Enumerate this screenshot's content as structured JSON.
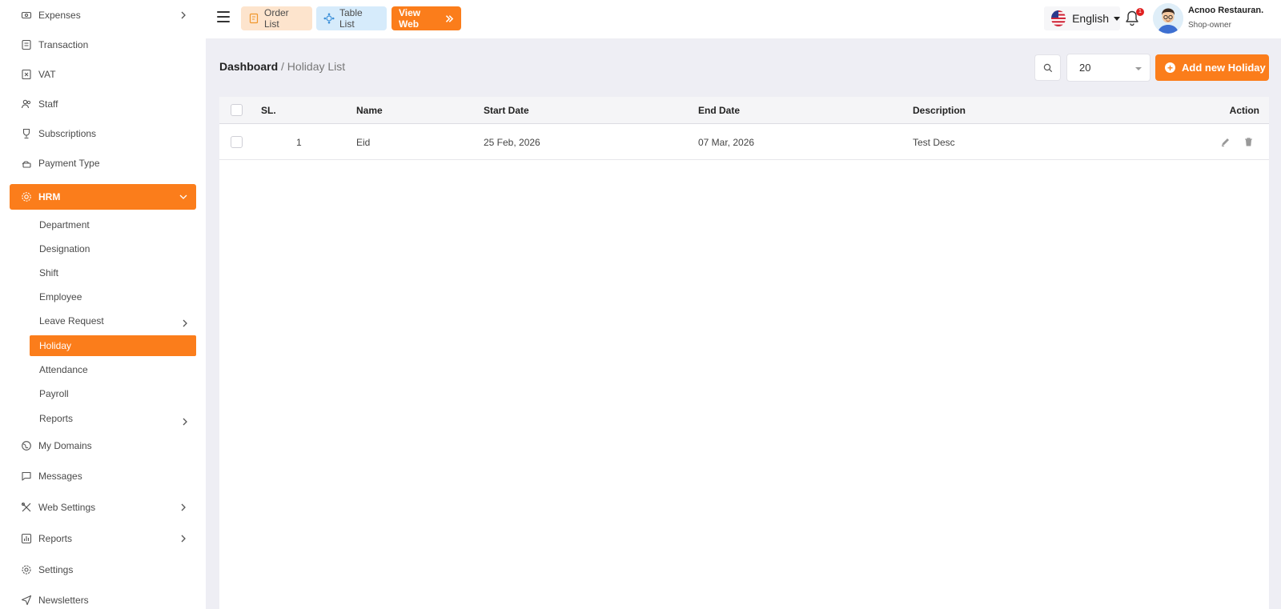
{
  "sidebar": {
    "items_top": [
      {
        "label": "Expenses",
        "icon": "expenses-icon"
      },
      {
        "label": "Transaction",
        "icon": "transaction-icon"
      },
      {
        "label": "VAT",
        "icon": "vat-icon"
      },
      {
        "label": "Staff",
        "icon": "staff-icon"
      },
      {
        "label": "Subscriptions",
        "icon": "subscriptions-icon"
      },
      {
        "label": "Payment Type",
        "icon": "payment-type-icon"
      }
    ],
    "hrm": {
      "label": "HRM",
      "icon": "hrm-icon"
    },
    "hrm_sub": [
      {
        "label": "Department"
      },
      {
        "label": "Designation"
      },
      {
        "label": "Shift"
      },
      {
        "label": "Employee"
      },
      {
        "label": "Leave Request"
      },
      {
        "label": "Holiday"
      },
      {
        "label": "Attendance"
      },
      {
        "label": "Payroll"
      },
      {
        "label": "Reports"
      }
    ],
    "items_bottom": [
      {
        "label": "My Domains",
        "icon": "domains-icon"
      },
      {
        "label": "Messages",
        "icon": "messages-icon"
      },
      {
        "label": "Web Settings",
        "icon": "web-settings-icon"
      },
      {
        "label": "Reports",
        "icon": "reports-icon"
      },
      {
        "label": "Settings",
        "icon": "settings-icon"
      },
      {
        "label": "Newsletters",
        "icon": "newsletters-icon"
      }
    ]
  },
  "header": {
    "order_list": "Order List",
    "table_list": "Table List",
    "view_web": "View Web",
    "language": "English",
    "notification_count": "1",
    "user_name": "Acnoo Restauran.",
    "user_role": "Shop-owner"
  },
  "breadcrumb": {
    "root": "Dashboard",
    "separator": " / ",
    "current": "Holiday List"
  },
  "toolbar": {
    "per_page": "20",
    "add_label": "Add new Holiday"
  },
  "table": {
    "headers": {
      "sl": "SL.",
      "name": "Name",
      "start": "Start Date",
      "end": "End Date",
      "description": "Description",
      "action": "Action"
    },
    "rows": [
      {
        "sl": "1",
        "name": "Eid",
        "start": "25 Feb, 2026",
        "end": "07 Mar, 2026",
        "description": "Test Desc"
      }
    ]
  },
  "colors": {
    "accent": "#fb7d1b",
    "order_bg": "#fde4cd",
    "table_bg": "#d6ebfb",
    "page_bg": "#eeeef4"
  }
}
